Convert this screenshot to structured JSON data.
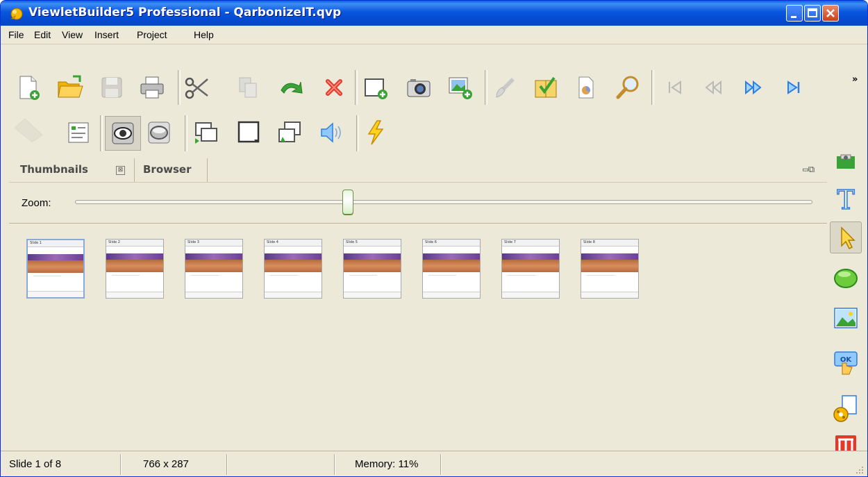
{
  "window": {
    "title": "ViewletBuilder5 Professional - QarbonizeIT.qvp"
  },
  "menu": [
    "File",
    "Edit",
    "View",
    "Insert",
    "Project",
    "Help"
  ],
  "toolbar_overflow": "»",
  "panel": {
    "tabs": [
      "Thumbnails",
      "Browser"
    ],
    "tab_close_glyph": "⊠",
    "restore_glyph": "▭⧉"
  },
  "zoom": {
    "label": "Zoom:",
    "value_fraction": 0.37
  },
  "slides": [
    {
      "label": "Slide 1",
      "caption": ""
    },
    {
      "label": "Slide 2",
      "caption": ""
    },
    {
      "label": "Slide 3",
      "caption": ""
    },
    {
      "label": "Slide 4",
      "caption": ""
    },
    {
      "label": "Slide 5",
      "caption": ""
    },
    {
      "label": "Slide 6",
      "caption": ""
    },
    {
      "label": "Slide 7",
      "caption": ""
    },
    {
      "label": "Slide 8",
      "caption": ""
    }
  ],
  "status": {
    "slide": "Slide 1 of 8",
    "size": "766 x 287",
    "memory": "Memory: 11%"
  },
  "colors": {
    "titlebar": "#0856dc",
    "face": "#ece9d8",
    "accent_green": "#3aa335"
  }
}
